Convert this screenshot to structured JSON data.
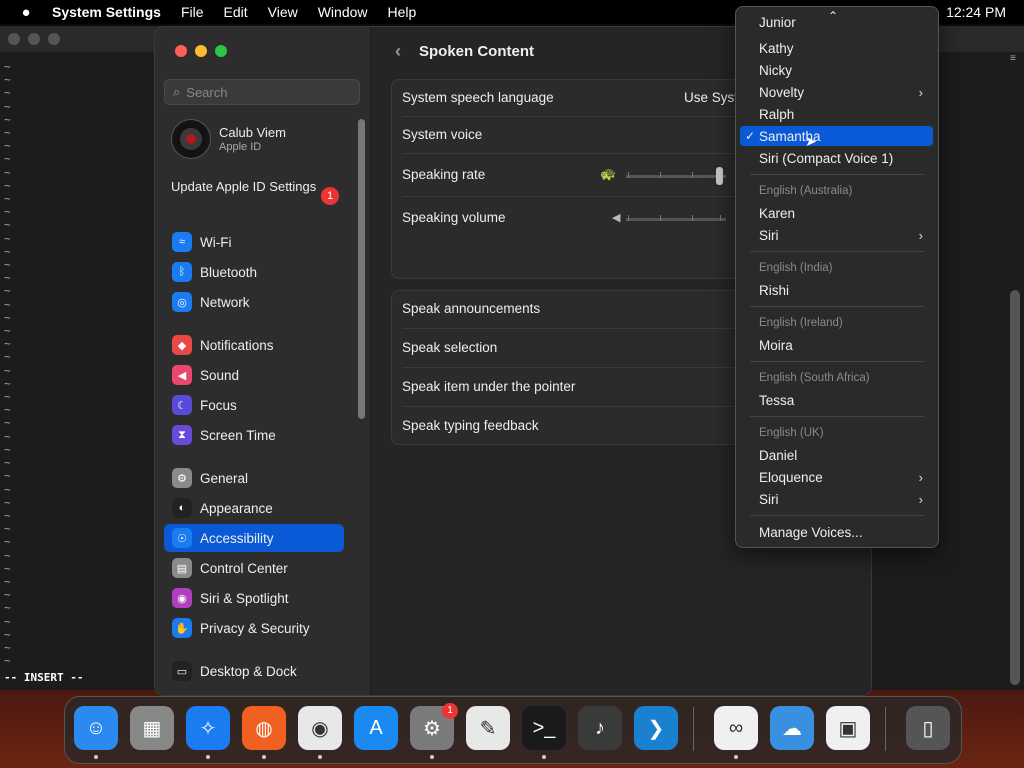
{
  "menubar": {
    "apple_icon": "apple-icon",
    "app_name": "System Settings",
    "items": [
      "File",
      "Edit",
      "View",
      "Window",
      "Help"
    ],
    "clock": "12:24 PM"
  },
  "terminal": {
    "tilde": "~",
    "mode": "-- INSERT --"
  },
  "sidebar": {
    "search_placeholder": "Search",
    "account_name": "Calub Viem",
    "account_sub": "Apple ID",
    "update_text": "Update Apple ID Settings",
    "update_badge": "1",
    "items": [
      {
        "label": "Wi-Fi",
        "icon": "wifi-icon",
        "color": "#1a7cf0"
      },
      {
        "label": "Bluetooth",
        "icon": "bluetooth-icon",
        "color": "#1a7cf0"
      },
      {
        "label": "Network",
        "icon": "network-icon",
        "color": "#1a7cf0"
      },
      {
        "label": "Notifications",
        "icon": "bell-icon",
        "color": "#e84848"
      },
      {
        "label": "Sound",
        "icon": "speaker-icon",
        "color": "#e84870"
      },
      {
        "label": "Focus",
        "icon": "moon-icon",
        "color": "#5a4ad8"
      },
      {
        "label": "Screen Time",
        "icon": "hourglass-icon",
        "color": "#6a4ad8"
      },
      {
        "label": "General",
        "icon": "gear-icon",
        "color": "#8a8a8a"
      },
      {
        "label": "Appearance",
        "icon": "appearance-icon",
        "color": "#222222"
      },
      {
        "label": "Accessibility",
        "icon": "accessibility-icon",
        "color": "#1a7cf0"
      },
      {
        "label": "Control Center",
        "icon": "control-center-icon",
        "color": "#8a8a8a"
      },
      {
        "label": "Siri & Spotlight",
        "icon": "siri-icon",
        "color": "#b040c0"
      },
      {
        "label": "Privacy & Security",
        "icon": "hand-icon",
        "color": "#1a7cf0"
      },
      {
        "label": "Desktop & Dock",
        "icon": "dock-icon",
        "color": "#222222"
      }
    ],
    "selected": "Accessibility"
  },
  "content": {
    "title": "Spoken Content",
    "group1": {
      "speech_language_label": "System speech language",
      "speech_language_value": "Use Syst",
      "system_voice_label": "System voice",
      "speaking_rate_label": "Speaking rate",
      "speaking_rate_level": 1.0,
      "speaking_volume_label": "Speaking volume"
    },
    "group2": [
      "Speak announcements",
      "Speak selection",
      "Speak item under the pointer",
      "Speak typing feedback"
    ]
  },
  "popup": {
    "top_clipped": "Junior",
    "items_en_us": [
      {
        "label": "Kathy",
        "submenu": false
      },
      {
        "label": "Nicky",
        "submenu": false
      },
      {
        "label": "Novelty",
        "submenu": true
      },
      {
        "label": "Ralph",
        "submenu": false
      },
      {
        "label": "Samantha",
        "submenu": false,
        "selected": true
      },
      {
        "label": "Siri (Compact Voice 1)",
        "submenu": false
      }
    ],
    "sections": [
      {
        "header": "English (Australia)",
        "items": [
          {
            "label": "Karen",
            "submenu": false
          },
          {
            "label": "Siri",
            "submenu": true
          }
        ]
      },
      {
        "header": "English (India)",
        "items": [
          {
            "label": "Rishi",
            "submenu": false
          }
        ]
      },
      {
        "header": "English (Ireland)",
        "items": [
          {
            "label": "Moira",
            "submenu": false
          }
        ]
      },
      {
        "header": "English (South Africa)",
        "items": [
          {
            "label": "Tessa",
            "submenu": false
          }
        ]
      },
      {
        "header": "English (UK)",
        "items": [
          {
            "label": "Daniel",
            "submenu": false
          },
          {
            "label": "Eloquence",
            "submenu": true
          },
          {
            "label": "Siri",
            "submenu": true
          }
        ]
      }
    ],
    "manage": "Manage Voices...",
    "checkmark": "✓",
    "submenu_glyph": "›"
  },
  "dock": {
    "apps": [
      {
        "name": "finder-icon",
        "color": "#2a8af0"
      },
      {
        "name": "launchpad-icon",
        "color": "#888888"
      },
      {
        "name": "safari-icon",
        "color": "#1a7cf0"
      },
      {
        "name": "firefox-icon",
        "color": "#f06020"
      },
      {
        "name": "chrome-icon",
        "color": "#e8e8e8"
      },
      {
        "name": "app-store-icon",
        "color": "#1a8af0"
      },
      {
        "name": "system-settings-icon",
        "color": "#7a7a7a",
        "badge": "1"
      },
      {
        "name": "textedit-icon",
        "color": "#e8e8e8"
      },
      {
        "name": "terminal-icon",
        "color": "#1a1a1a"
      },
      {
        "name": "garageband-icon",
        "color": "#3a3a3a"
      },
      {
        "name": "vscode-icon",
        "color": "#1a80d0"
      },
      {
        "name": "visual-studio-icon",
        "color": "#f0f0f0"
      },
      {
        "name": "weather-icon",
        "color": "#3a90e0"
      },
      {
        "name": "system-information-icon",
        "color": "#f0f0f0"
      },
      {
        "name": "trash-icon",
        "color": "#555555"
      }
    ]
  }
}
